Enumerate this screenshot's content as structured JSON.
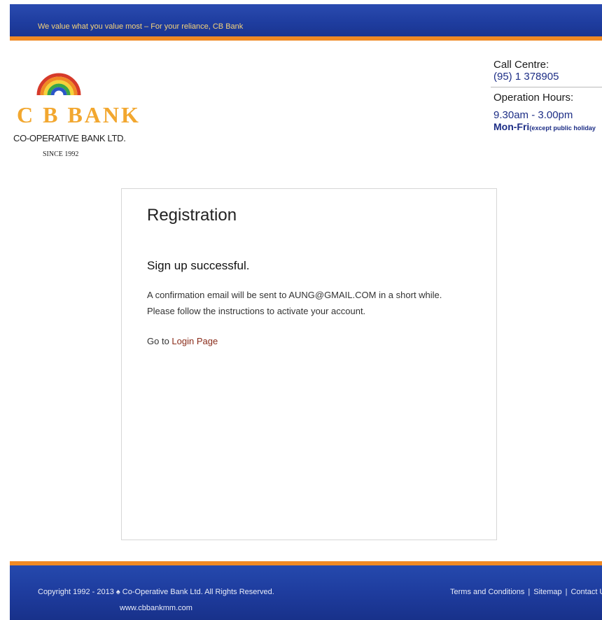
{
  "header": {
    "tagline": "We value what you value most – For your reliance, CB Bank"
  },
  "logo": {
    "brand": "C B BANK",
    "company": "CO-OPERATIVE BANK LTD.",
    "since": "SINCE 1992"
  },
  "contact": {
    "call_label": "Call Centre:",
    "call_number": "(95) 1 378905",
    "hours_label": "Operation Hours:",
    "hours": "9.30am - 3.00pm",
    "days": "Mon-Fri",
    "days_note": "(except public holiday"
  },
  "main": {
    "title": "Registration",
    "heading": "Sign up successful.",
    "line1": "A confirmation email will be sent to AUNG@GMAIL.COM in a short while.",
    "line2": "Please follow the instructions to activate your account.",
    "goto_prefix": "Go to",
    "login_link": "Login Page"
  },
  "footer": {
    "copyright": "Copyright 1992 - 2013 ♠ Co-Operative Bank Ltd. All Rights Reserved.",
    "website": "www.cbbankmm.com",
    "links": [
      "Terms and Conditions",
      "Sitemap",
      "Contact U"
    ]
  },
  "colors": {
    "bar_blue": "#1e3c9e",
    "bar_orange": "#f08a24",
    "brand_gold": "#f2a72f",
    "contact_blue": "#1d2e86",
    "link_red": "#8a2c1a"
  }
}
